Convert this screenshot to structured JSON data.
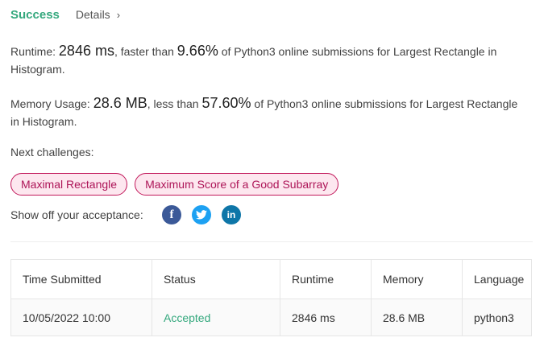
{
  "header": {
    "status": "Success",
    "details_label": "Details",
    "chevron": "›"
  },
  "runtime": {
    "label": "Runtime:",
    "value": "2846 ms",
    "compare_text": ", faster than",
    "percent": "9.66%",
    "suffix": "of Python3 online submissions for Largest Rectangle in Histogram."
  },
  "memory": {
    "label": "Memory Usage:",
    "value": "28.6 MB",
    "compare_text": ", less than",
    "percent": "57.60%",
    "suffix": "of Python3 online submissions for Largest Rectangle in Histogram."
  },
  "next_challenges": {
    "label": "Next challenges:",
    "items": [
      "Maximal Rectangle",
      "Maximum Score of a Good Subarray"
    ]
  },
  "share": {
    "label": "Show off your acceptance:",
    "icons": [
      "facebook-icon",
      "twitter-icon",
      "linkedin-icon"
    ]
  },
  "table": {
    "headers": [
      "Time Submitted",
      "Status",
      "Runtime",
      "Memory",
      "Language"
    ],
    "rows": [
      [
        "10/05/2022 10:00",
        "Accepted",
        "2846 ms",
        "28.6 MB",
        "python3"
      ]
    ]
  },
  "colors": {
    "success": "#34a87d",
    "chip_border": "#c2185b",
    "chip_bg": "#fde7ef",
    "facebook": "#3b5998",
    "twitter": "#1da1f2",
    "linkedin": "#0e76a8"
  }
}
